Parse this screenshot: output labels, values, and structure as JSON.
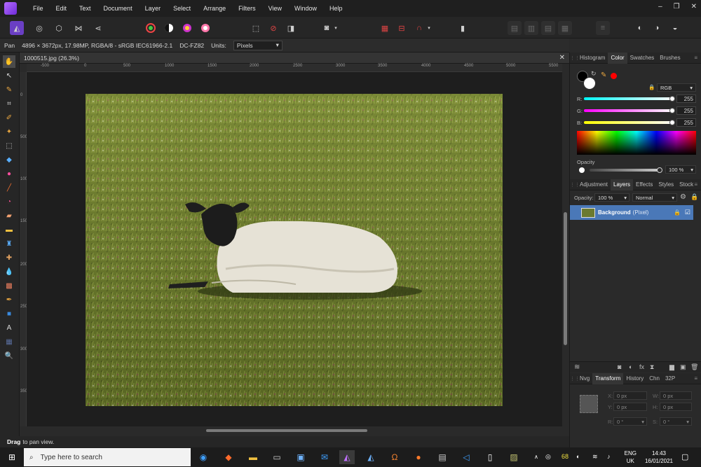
{
  "menu": [
    "File",
    "Edit",
    "Text",
    "Document",
    "Layer",
    "Select",
    "Arrange",
    "Filters",
    "View",
    "Window",
    "Help"
  ],
  "window_controls": {
    "minimize": "–",
    "restore": "❐",
    "close": "✕"
  },
  "context_bar": {
    "tool": "Pan",
    "info": "4896 × 3672px, 17.98MP, RGBA/8 - sRGB IEC61966-2.1",
    "camera": "DC-FZ82",
    "units_label": "Units:",
    "units_value": "Pixels"
  },
  "document": {
    "tab_title": "1000515.jpg (26.3%)",
    "close": "✕"
  },
  "ruler": {
    "h_ticks": [
      "-500",
      "0",
      "500",
      "1000",
      "1500",
      "2000",
      "2500",
      "3000",
      "3500",
      "4000",
      "4500",
      "5000",
      "5500"
    ],
    "v_ticks": [
      "0",
      "500",
      "1000",
      "1500",
      "2000",
      "2500",
      "3000",
      "3500"
    ]
  },
  "color_panel": {
    "tabs": [
      "Histogram",
      "Color",
      "Swatches",
      "Brushes"
    ],
    "active_tab": "Color",
    "mode": "RGB",
    "r_label": "R:",
    "r_value": "255",
    "g_label": "G:",
    "g_value": "255",
    "b_label": "B:",
    "b_value": "255",
    "opacity_label": "Opacity",
    "opacity_value": "100 %"
  },
  "layers_panel": {
    "tabs": [
      "Adjustment",
      "Layers",
      "Effects",
      "Styles",
      "Stock"
    ],
    "active_tab": "Layers",
    "opacity_label": "Opacity:",
    "opacity_value": "100 %",
    "blend_mode": "Normal",
    "layer_name": "Background",
    "layer_type": "(Pixel)"
  },
  "transform_panel": {
    "tabs": [
      "Nvg",
      "Transform",
      "History",
      "Chn",
      "32P"
    ],
    "active_tab": "Transform",
    "x_label": "X:",
    "x_value": "0 px",
    "y_label": "Y:",
    "y_value": "0 px",
    "w_label": "W:",
    "w_value": "0 px",
    "h_label": "H:",
    "h_value": "0 px",
    "r_label": "R:",
    "r_value": "0 °",
    "s_label": "S:",
    "s_value": "0 °"
  },
  "status_bar": {
    "bold": "Drag",
    "text": "to pan view."
  },
  "taskbar": {
    "search_placeholder": "Type here to search",
    "badge": "68",
    "lang_top": "ENG",
    "lang_bottom": "UK",
    "time": "14:43",
    "date": "16/01/2021"
  },
  "colors": {
    "accent": "#4a78b8",
    "primary_fg": "#000000",
    "secondary_fg": "#ffffff",
    "swatch_red": "#ff0000"
  }
}
